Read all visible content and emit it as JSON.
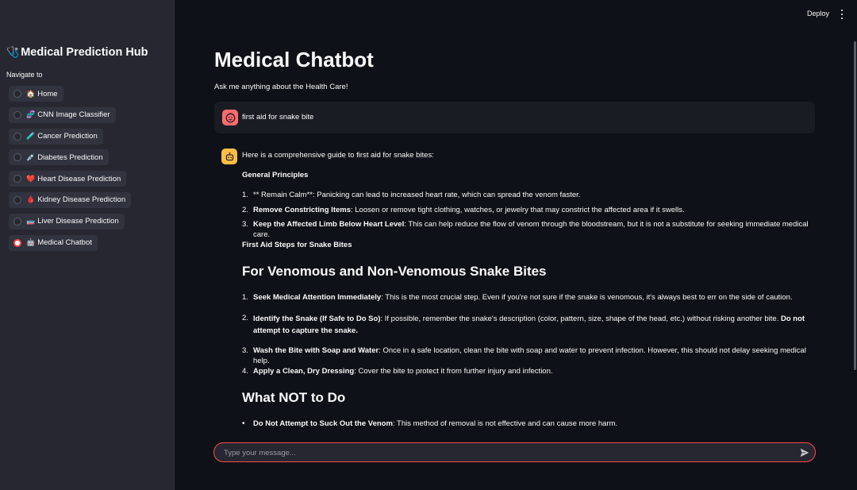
{
  "header": {
    "deploy_label": "Deploy"
  },
  "sidebar": {
    "title_icon": "🩺",
    "title": "Medical Prediction Hub",
    "nav_label": "Navigate to",
    "items": [
      {
        "icon": "🏠",
        "label": "Home"
      },
      {
        "icon": "🧬",
        "label": "CNN Image Classifier"
      },
      {
        "icon": "🧪",
        "label": "Cancer Prediction"
      },
      {
        "icon": "💉",
        "label": "Diabetes Prediction"
      },
      {
        "icon": "❤️",
        "label": "Heart Disease Prediction"
      },
      {
        "icon": "🩸",
        "label": "Kidney Disease Prediction"
      },
      {
        "icon": "🧫",
        "label": "Liver Disease Prediction"
      },
      {
        "icon": "🤖",
        "label": "Medical Chatbot"
      }
    ],
    "selected_index": 7
  },
  "main": {
    "title": "Medical Chatbot",
    "subtitle": "Ask me anything about the Health Care!",
    "user_message": "first aid for snake bite",
    "bot": {
      "intro": "Here is a comprehensive guide to first aid for snake bites:",
      "general_heading": "General Principles",
      "principles": [
        {
          "num": "1.",
          "bold": "",
          "text": "** Remain Calm**: Panicking can lead to increased heart rate, which can spread the venom faster."
        },
        {
          "num": "2.",
          "bold": "Remove Constricting Items",
          "text": ": Loosen or remove tight clothing, watches, or jewelry that may constrict the affected area if it swells."
        },
        {
          "num": "3.",
          "bold": "Keep the Affected Limb Below Heart Level",
          "text": ": This can help reduce the flow of venom through the bloodstream, but it is not a substitute for seeking immediate medical care."
        }
      ],
      "steps_heading": "First Aid Steps for Snake Bites",
      "section1_heading": "For Venomous and Non-Venomous Snake Bites",
      "steps": [
        {
          "num": "1.",
          "bold": "Seek Medical Attention Immediately",
          "text": ": This is the most crucial step. Even if you're not sure if the snake is venomous, it's always best to err on the side of caution."
        },
        {
          "num": "2.",
          "bold": "Identify the Snake (If Safe to Do So)",
          "text": ": If possible, remember the snake's description (color, pattern, size, shape of the head, etc.) without risking another bite. ",
          "bold2": "Do not attempt to capture the snake."
        },
        {
          "num": "3.",
          "bold": "Wash the Bite with Soap and Water",
          "text": ": Once in a safe location, clean the bite with soap and water to prevent infection. However, this should not delay seeking medical help."
        },
        {
          "num": "4.",
          "bold": "Apply a Clean, Dry Dressing",
          "text": ": Cover the bite to protect it from further injury and infection."
        }
      ],
      "section2_heading": "What NOT to Do",
      "donts": [
        {
          "bold": "Do Not Attempt to Suck Out the Venom",
          "text": ": This method of removal is not effective and can cause more harm."
        }
      ]
    }
  },
  "chat_input": {
    "placeholder": "Type your message..."
  },
  "colors": {
    "accent": "#ff4b4b",
    "background": "#0e1117",
    "sidebar": "#262730",
    "bot_avatar": "#ffbd45",
    "user_avatar": "#ff6c6c"
  }
}
